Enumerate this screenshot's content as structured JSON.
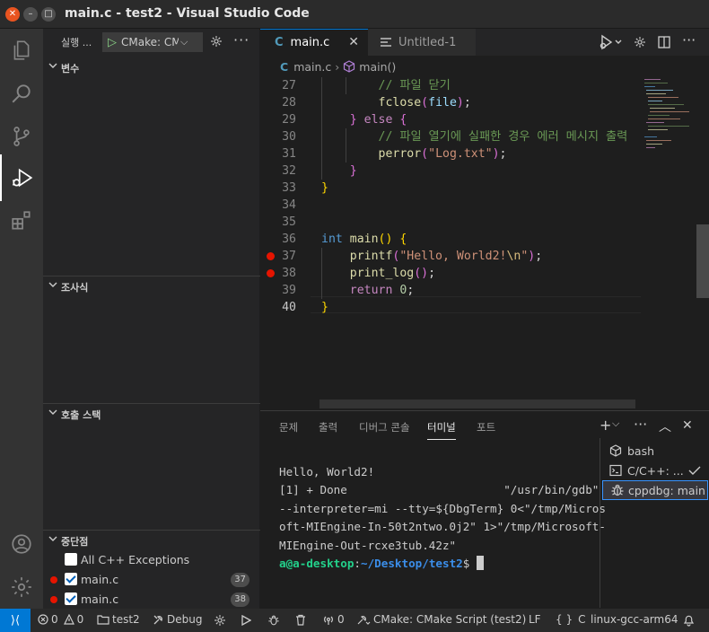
{
  "window": {
    "title": "main.c - test2 - Visual Studio Code"
  },
  "sidebar": {
    "title": "실행 ...",
    "launch_config": "CMake: CM",
    "sections": {
      "variables": "변수",
      "watch": "조사식",
      "call_stack": "호출 스택",
      "breakpoints": "중단점"
    },
    "breakpoints": [
      {
        "label": "All C++ Exceptions",
        "checked": false
      },
      {
        "label": "main.c",
        "checked": true,
        "count": "37"
      },
      {
        "label": "main.c",
        "checked": true,
        "count": "38"
      }
    ]
  },
  "tabs": [
    {
      "label": "main.c",
      "icon": "C"
    },
    {
      "label": "Untitled-1"
    }
  ],
  "breadcrumb": {
    "icon": "C",
    "file": "main.c",
    "symbol": "main()"
  },
  "editor": {
    "lines": [
      {
        "num": "27",
        "html": "        <span class=\"cm\">// 파일 닫기</span>"
      },
      {
        "num": "28",
        "html": "        <span class=\"f\">fclose</span><span class=\"p2\">(</span><span class=\"v\">file</span><span class=\"p2\">)</span>;"
      },
      {
        "num": "29",
        "html": "    <span class=\"p2\">}</span> <span class=\"kc\">else</span> <span class=\"p2\">{</span>"
      },
      {
        "num": "30",
        "html": "        <span class=\"cm\">// 파일 열기에 실패한 경우 에러 메시지 출력</span>"
      },
      {
        "num": "31",
        "html": "        <span class=\"f\">perror</span><span class=\"p2\">(</span><span class=\"s\">\"Log.txt\"</span><span class=\"p2\">)</span>;"
      },
      {
        "num": "32",
        "html": "    <span class=\"p2\">}</span>"
      },
      {
        "num": "33",
        "html": "<span class=\"p\">}</span>"
      },
      {
        "num": "34",
        "html": ""
      },
      {
        "num": "35",
        "html": ""
      },
      {
        "num": "36",
        "html": "<span class=\"k\">int</span> <span class=\"f\">main</span><span class=\"p\">()</span> <span class=\"p\">{</span>"
      },
      {
        "num": "37",
        "html": "    <span class=\"f\">printf</span><span class=\"p2\">(</span><span class=\"s\">\"Hello, World2!</span><span class=\"e\">\\n</span><span class=\"s\">\"</span><span class=\"p2\">)</span>;",
        "bp": true
      },
      {
        "num": "38",
        "html": "    <span class=\"f\">print_log</span><span class=\"p2\">()</span>;",
        "bp": true
      },
      {
        "num": "39",
        "html": "    <span class=\"kc\">return</span> <span class=\"n\">0</span>;"
      },
      {
        "num": "40",
        "html": "<span class=\"p\">}</span>",
        "current": true
      }
    ]
  },
  "panel": {
    "tabs": [
      "문제",
      "출력",
      "디버그 콘솔",
      "터미널",
      "포트"
    ],
    "active_tab": "터미널",
    "terminal": {
      "output": [
        "Hello, World2!",
        "[1] + Done                       \"/usr/bin/gdb\"",
        "--interpreter=mi --tty=${DbgTerm} 0<\"/tmp/Micros",
        "oft-MIEngine-In-50t2ntwo.0j2\" 1>\"/tmp/Microsoft-",
        "MIEngine-Out-rcxe3tub.42z\""
      ],
      "prompt_user": "a@a-desktop",
      "prompt_sep": ":",
      "prompt_path": "~/Desktop/test2",
      "prompt_end": "$ "
    },
    "terminal_list": [
      {
        "label": "bash",
        "icon": "bash-icon"
      },
      {
        "label": "C/C++: ...",
        "icon": "terminal-icon"
      },
      {
        "label": "cppdbg: main",
        "icon": "debug-icon"
      }
    ]
  },
  "statusbar": {
    "errors": "0",
    "warnings": "0",
    "project": "test2",
    "build_type": "Debug",
    "ports": "0",
    "cmake": "CMake: CMake Script (test2)",
    "eol": "LF",
    "language": "C",
    "kit": "linux-gcc-arm64"
  },
  "colors": {
    "accent": "#0078d4",
    "breakpoint": "#e51400",
    "terminal_green": "#23d18b",
    "terminal_blue": "#3b8eea"
  }
}
